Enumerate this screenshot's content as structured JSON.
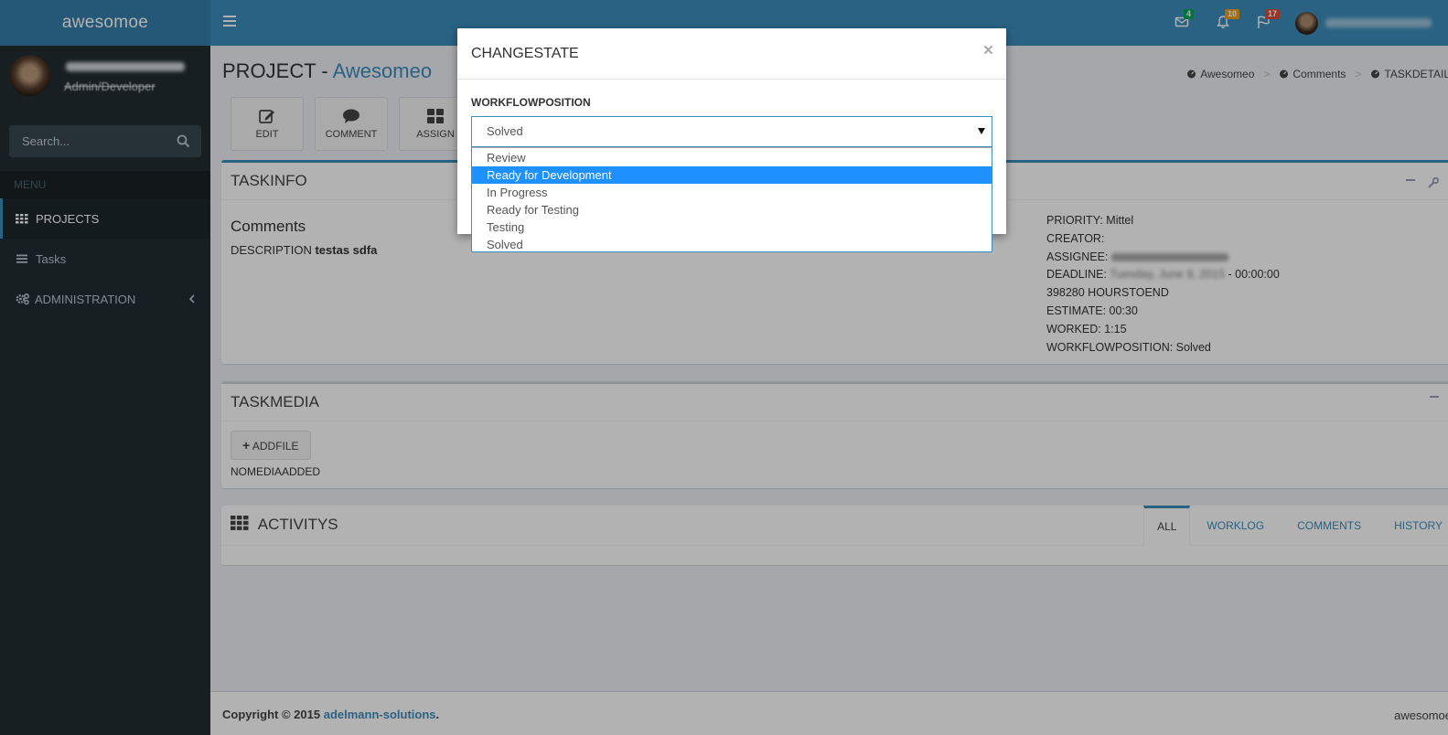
{
  "app": {
    "logo": "awesomoe"
  },
  "topbar": {
    "mail_badge": "4",
    "notifications_badge": "10",
    "flags_badge": "17",
    "colors": {
      "mail_badge": "#00a65a",
      "notifications_badge": "#f39c12",
      "flags_badge": "#dd4b39"
    }
  },
  "sidebar": {
    "user_role": "Admin/Developer",
    "search_placeholder": "Search...",
    "menu_header": "MENU",
    "items": [
      {
        "label": "PROJECTS"
      },
      {
        "label": "Tasks"
      },
      {
        "label": "ADMINISTRATION"
      }
    ]
  },
  "page": {
    "title_prefix": "PROJECT - ",
    "title_project": "Awesomeo",
    "breadcrumb": [
      "Awesomeo",
      "Comments",
      "TASKDETAILS"
    ]
  },
  "actions": {
    "edit": "EDIT",
    "comment": "COMMENT",
    "assign": "ASSIGN"
  },
  "taskinfo": {
    "header": "TASKINFO",
    "title": "Comments",
    "description_label": "DESCRIPTION",
    "description_value": "testas sdfa",
    "priority": "PRIORITY: Mittel",
    "creator": "CREATOR:",
    "assignee_label": "ASSIGNEE:",
    "deadline_label": "DEADLINE:",
    "deadline_blurred": "Tuesday, June 9, 2015",
    "deadline_time": " - 00:00:00",
    "hours_to_end": "398280 HOURSTOEND",
    "estimate": "ESTIMATE: 00:30",
    "worked": "WORKED: 1:15",
    "workflow": "WORKFLOWPOSITION: Solved"
  },
  "taskmedia": {
    "header": "TASKMEDIA",
    "add_file": "ADDFILE",
    "empty": "NOMEDIAADDED"
  },
  "activitys": {
    "header": "ACTIVITYS",
    "tabs": [
      "ALL",
      "WORKLOG",
      "COMMENTS",
      "HISTORY"
    ]
  },
  "footer": {
    "copyright": "Copyright © 2015 ",
    "company": "adelmann-solutions",
    "dot": ".",
    "right": "awesomoe"
  },
  "modal": {
    "title": "CHANGESTATE",
    "close": "×",
    "field_label": "WORKFLOWPOSITION",
    "selected_value": "Solved",
    "options": [
      "Review",
      "Ready for Development",
      "In Progress",
      "Ready for Testing",
      "Testing",
      "Solved"
    ],
    "highlighted_option": "Ready for Development"
  }
}
